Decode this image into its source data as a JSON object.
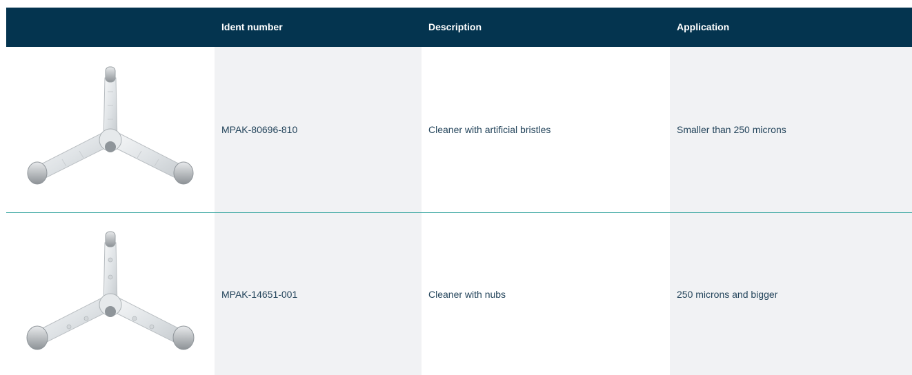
{
  "header": {
    "image_col": "",
    "ident_col": "Ident number",
    "description_col": "Description",
    "application_col": "Application",
    "background_color": "#04344f"
  },
  "rows": [
    {
      "image_icon": "tri-arm-cleaner-bristles-image",
      "ident": "MPAK-80696-810",
      "description": "Cleaner with artificial bristles",
      "application": "Smaller than 250 microns"
    },
    {
      "image_icon": "tri-arm-cleaner-nubs-image",
      "ident": "MPAK-14651-001",
      "description": "Cleaner with nubs",
      "application": "250 microns and bigger"
    }
  ],
  "colors": {
    "header_bg": "#04344f",
    "shaded_cell": "#f1f2f4",
    "divider": "#39a6a1",
    "text": "#22435a"
  }
}
